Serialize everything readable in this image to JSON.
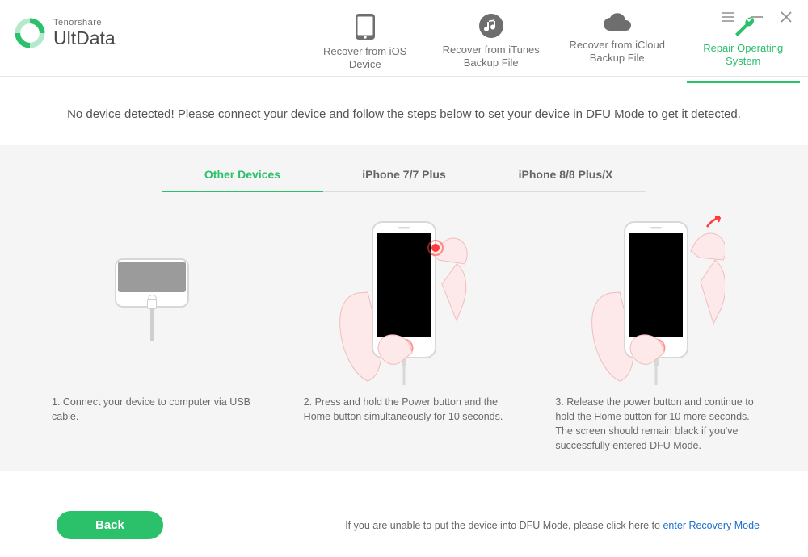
{
  "brand": {
    "company": "Tenorshare",
    "product": "UltData"
  },
  "main_tabs": [
    {
      "label": "Recover from iOS\nDevice"
    },
    {
      "label": "Recover from iTunes\nBackup File"
    },
    {
      "label": "Recover from iCloud\nBackup File"
    },
    {
      "label": "Repair Operating\nSystem"
    }
  ],
  "notice": "No device detected! Please connect your device and follow the steps below to set your device in DFU Mode to get it detected.",
  "device_tabs": [
    {
      "label": "Other Devices"
    },
    {
      "label": "iPhone 7/7 Plus"
    },
    {
      "label": "iPhone 8/8 Plus/X"
    }
  ],
  "steps": {
    "s1": "1. Connect your device to computer via USB cable.",
    "s2": "2. Press and hold the Power button and the Home button simultaneously for 10 seconds.",
    "s3": "3. Release the power button and continue to hold the Home button for 10 more seconds. The screen should remain black if you've successfully entered DFU Mode."
  },
  "back_button": "Back",
  "tip_prefix": "If you are unable to put the device into DFU Mode, please click here to ",
  "tip_link": "enter Recovery Mode"
}
